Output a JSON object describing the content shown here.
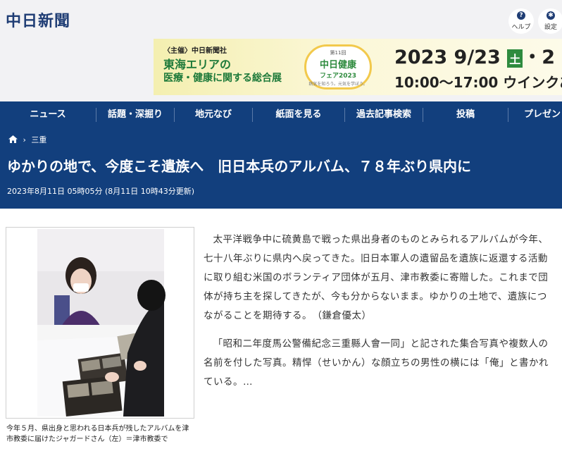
{
  "header": {
    "logo": "中日新聞",
    "help_label": "ヘルプ",
    "settings_label": "設定"
  },
  "banner": {
    "host": "〈主催〉中日新聞社",
    "line1": "東海エリアの",
    "line2": "医療・健康に関する総合展",
    "badge_small": "第11回",
    "badge_main": "中日健康",
    "badge_sub": "フェア2023",
    "badge_tag": "病気を知ろう。元気を学ぼう。",
    "date": "2023 9/23",
    "day": "土",
    "date_tail": "・2",
    "time": "10:00〜17:00 ウインクあ"
  },
  "nav": {
    "items": [
      "ニュース",
      "話題・深掘り",
      "地元なび",
      "紙面を見る",
      "過去記事検索",
      "投稿",
      "プレゼン"
    ]
  },
  "breadcrumb": {
    "section": "三重"
  },
  "article": {
    "headline": "ゆかりの地で、今度こそ遺族へ　旧日本兵のアルバム、７８年ぶり県内に",
    "timestamp": "2023年8月11日 05時05分 (8月11日 10時43分更新)",
    "caption": "今年５月、県出身と思われる日本兵が残したアルバムを津市教委に届けたジャガードさん（左）＝津市教委で",
    "paragraphs": [
      "太平洋戦争中に硫黄島で戦った県出身者のものとみられるアルバムが今年、七十八年ぶりに県内へ戻ってきた。旧日本軍人の遺留品を遺族に返還する活動に取り組む米国のボランティア団体が五月、津市教委に寄贈した。これまで団体が持ち主を探してきたが、今も分からないまま。ゆかりの土地で、遺族につながることを期待する。　（鎌倉優太）",
      "「昭和二年度馬公警備紀念三重縣人會一同」と記された集合写真や複数人の名前を付した写真。精悍（せいかん）な顔立ちの男性の横には「俺」と書かれている。…"
    ]
  },
  "colors": {
    "nav_bg": "#123f7d",
    "brand": "#1f3d74"
  }
}
